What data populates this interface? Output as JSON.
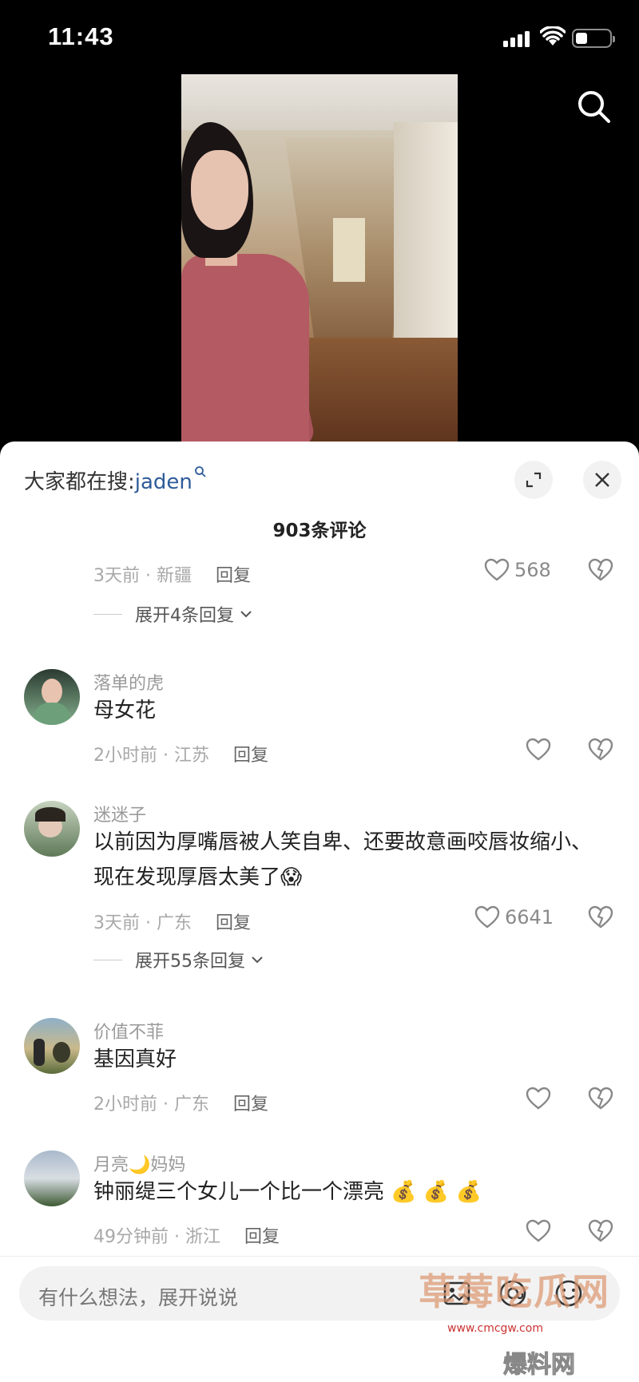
{
  "status_bar": {
    "time": "11:43"
  },
  "sheet": {
    "search_prefix": "大家都在搜:",
    "search_keyword": "jaden",
    "title": "903条评论"
  },
  "comments": [
    {
      "meta": "3天前 · 新疆",
      "reply_label": "回复",
      "likes": "568",
      "expand": "展开4条回复"
    },
    {
      "username": "落单的虎",
      "text": "母女花",
      "meta": "2小时前 · 江苏",
      "reply_label": "回复"
    },
    {
      "username": "迷迷子",
      "text": "以前因为厚嘴唇被人笑自卑、还要故意画咬唇妆缩小、现在发现厚唇太美了😱",
      "meta": "3天前 · 广东",
      "reply_label": "回复",
      "likes": "6641",
      "expand": "展开55条回复"
    },
    {
      "username": "价值不菲",
      "text": "基因真好",
      "meta": "2小时前 · 广东",
      "reply_label": "回复"
    },
    {
      "username": "月亮🌙妈妈",
      "text": "钟丽缇三个女儿一个比一个漂亮 💰 💰 💰",
      "meta": "49分钟前 · 浙江",
      "reply_label": "回复"
    }
  ],
  "composer": {
    "placeholder": "有什么想法，展开说说",
    "watermark": "草莓吃瓜网",
    "watermark_url": "www.cmcgw.com",
    "watermark_badge": "爆料网"
  },
  "colors": {
    "link": "#2e5c99",
    "background": "#000000",
    "sheet": "#ffffff"
  }
}
